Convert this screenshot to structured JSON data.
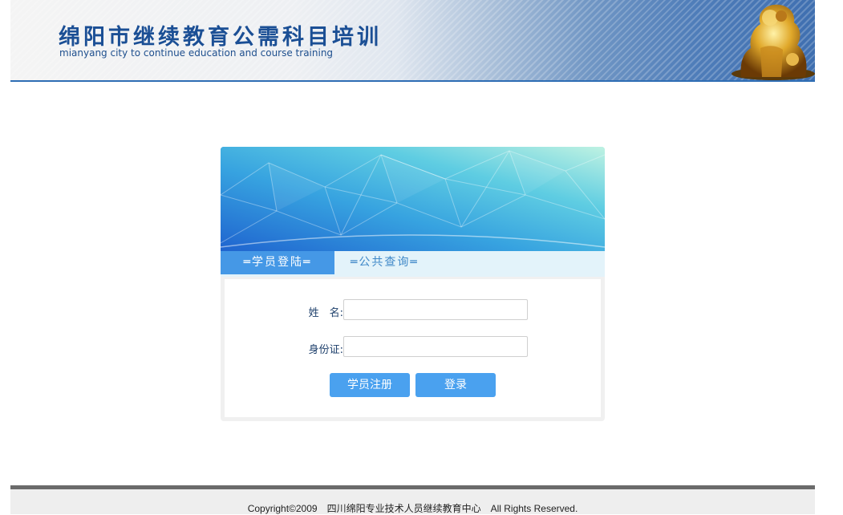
{
  "header": {
    "title": "绵阳市继续教育公需科目培训",
    "subtitle": "mianyang city to continue education and course training",
    "emblem": "golden-lion-image"
  },
  "login": {
    "tabs": [
      {
        "label": "═学员登陆═",
        "active": true
      },
      {
        "label": "═公共查询═",
        "active": false
      }
    ],
    "name_label": "姓　名:",
    "name_value": "",
    "id_label": "身份证:",
    "id_value": "",
    "register_label": "学员注册",
    "login_label": "登录"
  },
  "footer": {
    "text": "Copyright©2009　四川绵阳专业技术人员继续教育中心　All Rights Reserved."
  },
  "colors": {
    "header_title": "#1b4f95",
    "accent": "#4598e6",
    "button": "#4aa1ef",
    "footer_bar": "#6b6b6b"
  }
}
